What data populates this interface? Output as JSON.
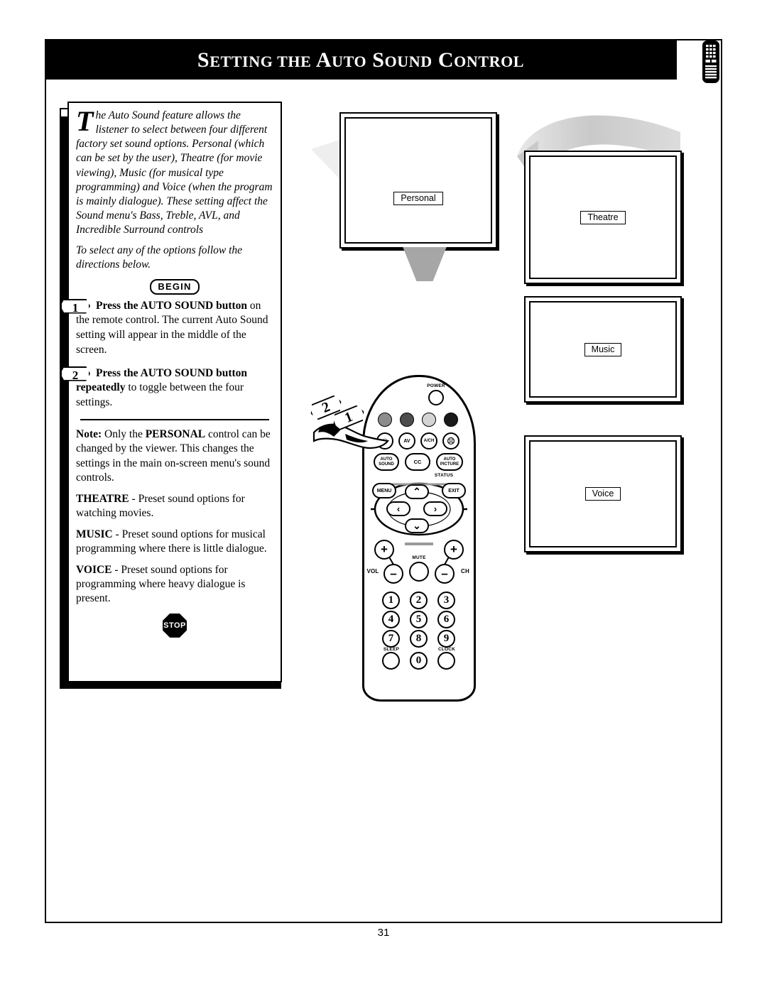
{
  "header": {
    "title_parts": [
      {
        "t": "S",
        "small": false
      },
      {
        "t": "ETTING",
        "small": true
      },
      {
        "t": " ",
        "small": true
      },
      {
        "t": "THE",
        "small": true
      },
      {
        "t": " A",
        "small": false
      },
      {
        "t": "UTO",
        "small": true
      },
      {
        "t": " S",
        "small": false
      },
      {
        "t": "OUND",
        "small": true
      },
      {
        "t": " C",
        "small": false
      },
      {
        "t": "ONTROL",
        "small": true
      }
    ],
    "title_plain": "SETTING THE AUTO SOUND CONTROL",
    "remote_icon": "remote-control-icon"
  },
  "intro": {
    "dropcap": "T",
    "paragraph1": "he Auto Sound feature allows the listener to select between four different factory set sound options. Personal (which can be set by the user), Theatre (for movie viewing), Music (for musical type programming) and Voice (when the program is mainly dialogue). These setting affect the Sound menu's Bass, Treble, AVL, and Incredible Surround controls",
    "paragraph2": "To select any of the options follow the directions below."
  },
  "begin_badge": "BEGIN",
  "steps": [
    {
      "number": "1",
      "bold_lead": "Press the AUTO  SOUND button",
      "rest": " on the remote control. The current Auto Sound setting will appear in the middle of the screen."
    },
    {
      "number": "2",
      "bold_lead": "Press the AUTO  SOUND button",
      "bold_lead2": "repeatedly",
      "rest": " to toggle between the four settings."
    }
  ],
  "notes": [
    {
      "lead": "Note:",
      "lead_bold_extra": "PERSONAL",
      "text_before": " Only the ",
      "text_after": " control can be changed by the viewer. This changes the settings in the main on-screen menu's sound controls."
    },
    {
      "lead": "THEATRE",
      "text": " - Preset sound options for watching movies."
    },
    {
      "lead": "MUSIC",
      "text": " - Preset sound options for musical programming where there is little dialogue."
    },
    {
      "lead": "VOICE",
      "text": " - Preset sound options for programming where heavy dialogue is present."
    }
  ],
  "stop_badge": "STOP",
  "tv_screens": [
    {
      "id": "personal",
      "label": "Personal"
    },
    {
      "id": "theatre",
      "label": "Theatre"
    },
    {
      "id": "music",
      "label": "Music"
    },
    {
      "id": "voice",
      "label": "Voice"
    }
  ],
  "callout": {
    "num_top": "2",
    "num_bottom": "1"
  },
  "remote": {
    "power_label": "POWER",
    "color_dots": [
      "#8c8c8c",
      "#4d4d4d",
      "#d4d4d4",
      "#1a1a1a"
    ],
    "icon_row": [
      "smiley-face-icon",
      "AV",
      "A/CH",
      "frowny-face-icon"
    ],
    "feature_row": [
      "AUTO SOUND",
      "CC",
      "AUTO PICTURE"
    ],
    "status_label": "STATUS",
    "menu_label": "MENU",
    "exit_label": "EXIT",
    "vol_label": "VOL",
    "ch_label": "CH",
    "mute_label": "MUTE",
    "plus": "+",
    "minus": "–",
    "arrow_up": "∧",
    "arrow_down": "∨",
    "arrow_left": "‹",
    "arrow_right": "›",
    "keypad": [
      "1",
      "2",
      "3",
      "4",
      "5",
      "6",
      "7",
      "8",
      "9"
    ],
    "sleep_label": "SLEEP",
    "clock_label": "CLOCK",
    "zero_key": "0"
  },
  "footer": {
    "page_number": "31"
  },
  "colors": {
    "ink": "#000000",
    "paper": "#ffffff",
    "beam_gray": "#a6a6a6",
    "sweep_gray": "#cfcfcf"
  }
}
